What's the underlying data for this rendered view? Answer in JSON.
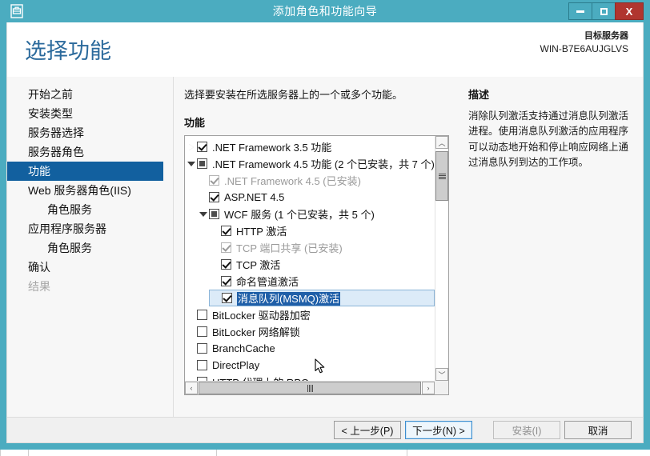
{
  "window": {
    "title": "添加角色和功能向导",
    "icon": "server-wizard-icon",
    "controls": {
      "minimize": "minimize-icon",
      "maximize": "maximize-icon",
      "close": "X"
    },
    "accent_color": "#4bacc0",
    "close_color": "#b0352f"
  },
  "header": {
    "page_title": "选择功能",
    "target_label": "目标服务器",
    "target_name": "WIN-B7E6AUJGLVS"
  },
  "sidebar": {
    "items": [
      {
        "label": "开始之前",
        "selected": false,
        "indent": false,
        "disabled": false
      },
      {
        "label": "安装类型",
        "selected": false,
        "indent": false,
        "disabled": false
      },
      {
        "label": "服务器选择",
        "selected": false,
        "indent": false,
        "disabled": false
      },
      {
        "label": "服务器角色",
        "selected": false,
        "indent": false,
        "disabled": false
      },
      {
        "label": "功能",
        "selected": true,
        "indent": false,
        "disabled": false
      },
      {
        "label": "Web 服务器角色(IIS)",
        "selected": false,
        "indent": false,
        "disabled": false
      },
      {
        "label": "角色服务",
        "selected": false,
        "indent": true,
        "disabled": false
      },
      {
        "label": "应用程序服务器",
        "selected": false,
        "indent": false,
        "disabled": false
      },
      {
        "label": "角色服务",
        "selected": false,
        "indent": true,
        "disabled": false
      },
      {
        "label": "确认",
        "selected": false,
        "indent": false,
        "disabled": false
      },
      {
        "label": "结果",
        "selected": false,
        "indent": false,
        "disabled": true
      }
    ],
    "selected_color": "#12609f"
  },
  "main": {
    "instruction": "选择要安装在所选服务器上的一个或多个功能。",
    "list_label": "功能",
    "tree": [
      {
        "label": ".NET Framework 3.5 功能",
        "indent": 0,
        "check": "checked",
        "twisty": "closed",
        "dim": false,
        "selected": false
      },
      {
        "label": ".NET Framework 4.5 功能 (2 个已安装，共 7 个)",
        "indent": 0,
        "check": "partial",
        "twisty": "open",
        "dim": false,
        "selected": false
      },
      {
        "label": ".NET Framework 4.5 (已安装)",
        "indent": 1,
        "check": "checked",
        "twisty": "none",
        "dim": true,
        "selected": false
      },
      {
        "label": "ASP.NET 4.5",
        "indent": 1,
        "check": "checked",
        "twisty": "none",
        "dim": false,
        "selected": false
      },
      {
        "label": "WCF 服务 (1 个已安装，共 5 个)",
        "indent": 1,
        "check": "partial",
        "twisty": "open",
        "dim": false,
        "selected": false
      },
      {
        "label": "HTTP 激活",
        "indent": 2,
        "check": "checked",
        "twisty": "none",
        "dim": false,
        "selected": false
      },
      {
        "label": "TCP 端口共享 (已安装)",
        "indent": 2,
        "check": "checked",
        "twisty": "none",
        "dim": true,
        "selected": false
      },
      {
        "label": "TCP 激活",
        "indent": 2,
        "check": "checked",
        "twisty": "none",
        "dim": false,
        "selected": false
      },
      {
        "label": "命名管道激活",
        "indent": 2,
        "check": "checked",
        "twisty": "none",
        "dim": false,
        "selected": false
      },
      {
        "label": "消息队列(MSMQ)激活",
        "indent": 2,
        "check": "checked",
        "twisty": "none",
        "dim": false,
        "selected": true
      },
      {
        "label": "BitLocker 驱动器加密",
        "indent": 0,
        "check": "unchecked",
        "twisty": "none",
        "dim": false,
        "selected": false
      },
      {
        "label": "BitLocker 网络解锁",
        "indent": 0,
        "check": "unchecked",
        "twisty": "none",
        "dim": false,
        "selected": false
      },
      {
        "label": "BranchCache",
        "indent": 0,
        "check": "unchecked",
        "twisty": "none",
        "dim": false,
        "selected": false
      },
      {
        "label": "DirectPlay",
        "indent": 0,
        "check": "unchecked",
        "twisty": "none",
        "dim": false,
        "selected": false
      },
      {
        "label": "HTTP 代理上的 RPC",
        "indent": 0,
        "check": "unchecked",
        "twisty": "none",
        "dim": false,
        "selected": false
      }
    ],
    "scroll": {
      "up_arrow": "︿",
      "down_arrow": "﹀",
      "left_arrow": "‹",
      "right_arrow": "›"
    }
  },
  "description": {
    "title": "描述",
    "text": "消除队列激活支持通过消息队列激活进程。使用消息队列激活的应用程序可以动态地开始和停止响应网络上通过消息队列到达的工作项。"
  },
  "footer": {
    "previous": "< 上一步(P)",
    "next": "下一步(N) >",
    "install": "安装(I)",
    "cancel": "取消"
  }
}
